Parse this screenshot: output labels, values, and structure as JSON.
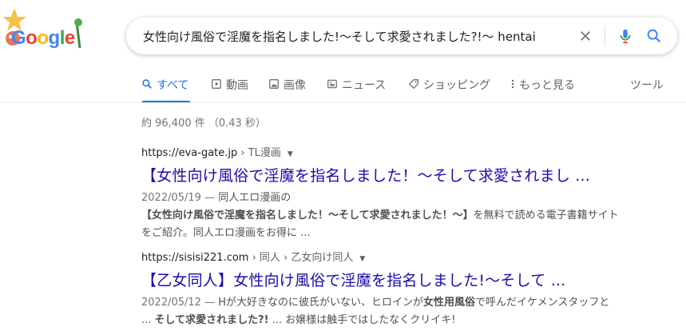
{
  "search": {
    "query": "女性向け風俗で淫魔を指名しました!〜そして求愛されました?!〜 hentai",
    "logo_text": "Google"
  },
  "tabs": [
    {
      "label": "すべて",
      "icon": "search-icon"
    },
    {
      "label": "動画",
      "icon": "video-icon"
    },
    {
      "label": "画像",
      "icon": "image-icon"
    },
    {
      "label": "ニュース",
      "icon": "news-icon"
    },
    {
      "label": "ショッピング",
      "icon": "tag-icon"
    },
    {
      "label": "もっと見る",
      "icon": "more-icon"
    }
  ],
  "tools_label": "ツール",
  "stats": "約 96,400 件 （0.43 秒）",
  "results": [
    {
      "url": "https://eva-gate.jp",
      "path": " › TL漫画",
      "title": "【女性向け風俗で淫魔を指名しました！〜そして求愛されまし ...",
      "date": "2022/05/19 — ",
      "snippet_html": "同人エロ漫画の<b>【女性向け風俗で淫魔を指名しました！〜そして求愛されました！〜】</b>を無料で読める電子書籍サイトをご紹介。同人エロ漫画をお得に ..."
    },
    {
      "url": "https://sisisi221.com",
      "path": " › 同人 › 乙女向け同人",
      "title": "【乙女同人】女性向け風俗で淫魔を指名しました!〜そして ...",
      "date": "2022/05/12 — ",
      "snippet_html": "Hが大好きなのに彼氏がいない、ヒロインが<b>女性用風俗</b>で呼んだイケメンスタッフと ... <b>そして求愛されました?!</b> ... お嬢様は触手ではしたなくクリイキ!"
    }
  ],
  "colors": {
    "link": "#1a0dab",
    "accent": "#1a73e8",
    "muted": "#70757a"
  }
}
